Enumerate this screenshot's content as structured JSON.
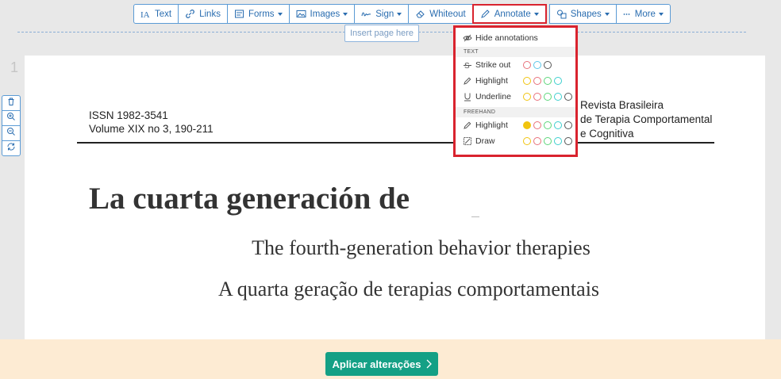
{
  "toolbar": {
    "text": "Text",
    "links": "Links",
    "forms": "Forms",
    "images": "Images",
    "sign": "Sign",
    "whiteout": "Whiteout",
    "annotate": "Annotate",
    "shapes": "Shapes",
    "more": "More"
  },
  "insert_page": "Insert page here",
  "page_number": "1",
  "side_tools": [
    "trash-icon",
    "zoom-in-icon",
    "zoom-out-icon",
    "rotate-icon"
  ],
  "document": {
    "issn": "ISSN 1982-3541",
    "volume": "Volume XIX no 3, 190-211",
    "journal_line1": "Revista Brasileira",
    "journal_line2": "de Terapia Comportamental",
    "journal_line3": "e Cognitiva",
    "title": "La cuarta generación de",
    "subtitle_en": "The fourth-generation behavior therapies",
    "subtitle_pt": "A quarta geração de terapias comportamentais"
  },
  "annotate_menu": {
    "hide": "Hide annotations",
    "section_text": "TEXT",
    "strike": "Strike out",
    "highlight": "Highlight",
    "underline": "Underline",
    "section_freehand": "FREEHAND",
    "fh_highlight": "Highlight",
    "draw": "Draw"
  },
  "colors": {
    "red": "#e8707a",
    "blue": "#5bc6e8",
    "black": "#555555",
    "yellow": "#f1c40f",
    "green": "#5cd67a",
    "teal": "#3ccfcf",
    "accent": "#d9232e",
    "apply": "#14a085"
  },
  "apply_button": "Aplicar alterações"
}
